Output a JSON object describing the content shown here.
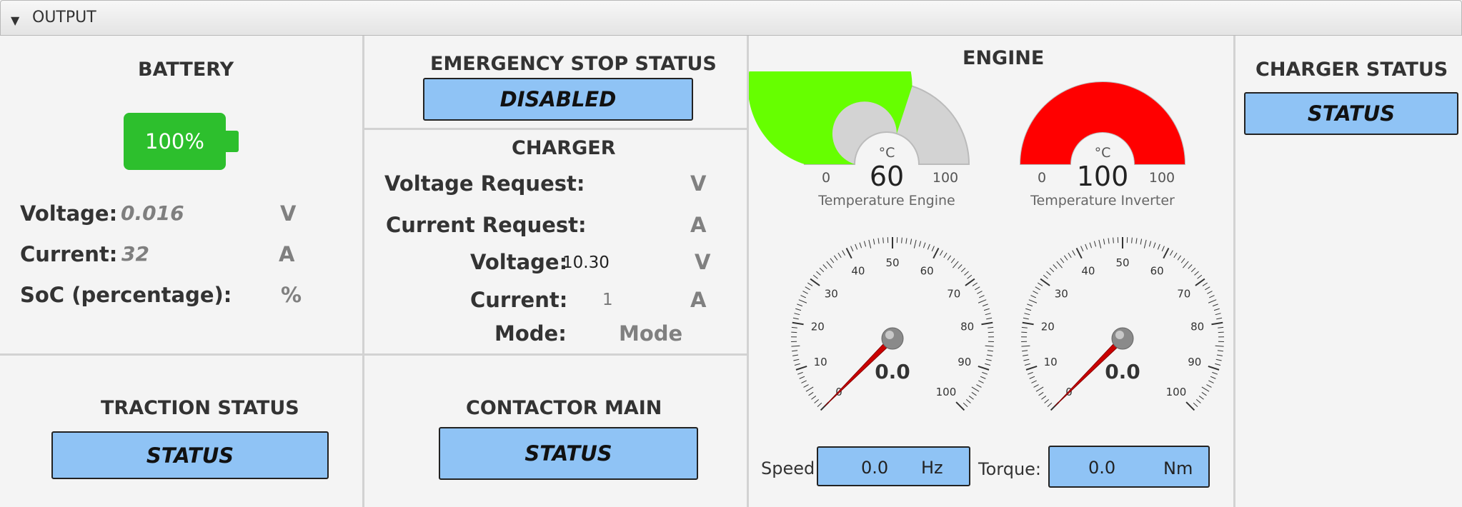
{
  "panel": {
    "title": "OUTPUT"
  },
  "battery": {
    "title": "BATTERY",
    "level_percent": 100,
    "level_text": "100%",
    "voltage_label": "Voltage:",
    "voltage_value": "0.016",
    "voltage_unit": "V",
    "current_label": "Current:",
    "current_value": "32",
    "current_unit": "A",
    "soc_label": "SoC (percentage):",
    "soc_unit": "%"
  },
  "emergency_stop": {
    "title": "EMERGENCY STOP STATUS",
    "status": "DISABLED"
  },
  "charger": {
    "title": "CHARGER",
    "voltage_request_label": "Voltage Request:",
    "voltage_request_unit": "V",
    "current_request_label": "Current Request:",
    "current_request_unit": "A",
    "voltage_label": "Voltage:",
    "voltage_value": "10.30",
    "voltage_unit": "V",
    "current_label": "Current:",
    "current_value": "1",
    "current_unit": "A",
    "mode_label": "Mode:",
    "mode_value": "Mode"
  },
  "engine": {
    "title": "ENGINE",
    "temp_engine": {
      "unit": "°C",
      "value": 60,
      "value_text": "60",
      "min": "0",
      "max": "100",
      "label": "Temperature Engine",
      "color": "#66ff00"
    },
    "temp_inverter": {
      "unit": "°C",
      "value": 100,
      "value_text": "100",
      "min": "0",
      "max": "100",
      "label": "Temperature Inverter",
      "color": "#ff0000"
    },
    "dial_left": {
      "value": 0.0,
      "value_text": "0.0",
      "ticks": [
        "0",
        "10",
        "20",
        "30",
        "40",
        "50",
        "60",
        "70",
        "80",
        "90",
        "100"
      ]
    },
    "dial_right": {
      "value": 0.0,
      "value_text": "0.0",
      "ticks": [
        "0",
        "10",
        "20",
        "30",
        "40",
        "50",
        "60",
        "70",
        "80",
        "90",
        "100"
      ]
    },
    "speed_label": "Speed:",
    "speed_value": "0.0",
    "speed_unit": "Hz",
    "torque_label": "Torque:",
    "torque_value": "0.0",
    "torque_unit": "Nm"
  },
  "charger_status": {
    "title": "CHARGER STATUS",
    "status": "STATUS"
  },
  "traction": {
    "title": "TRACTION STATUS",
    "status": "STATUS"
  },
  "contactor": {
    "title": "CONTACTOR MAIN",
    "status": "STATUS"
  },
  "colors": {
    "button_fill": "#8fc3f5",
    "battery_green": "#2dbf2d",
    "needle": "#cc0000"
  }
}
